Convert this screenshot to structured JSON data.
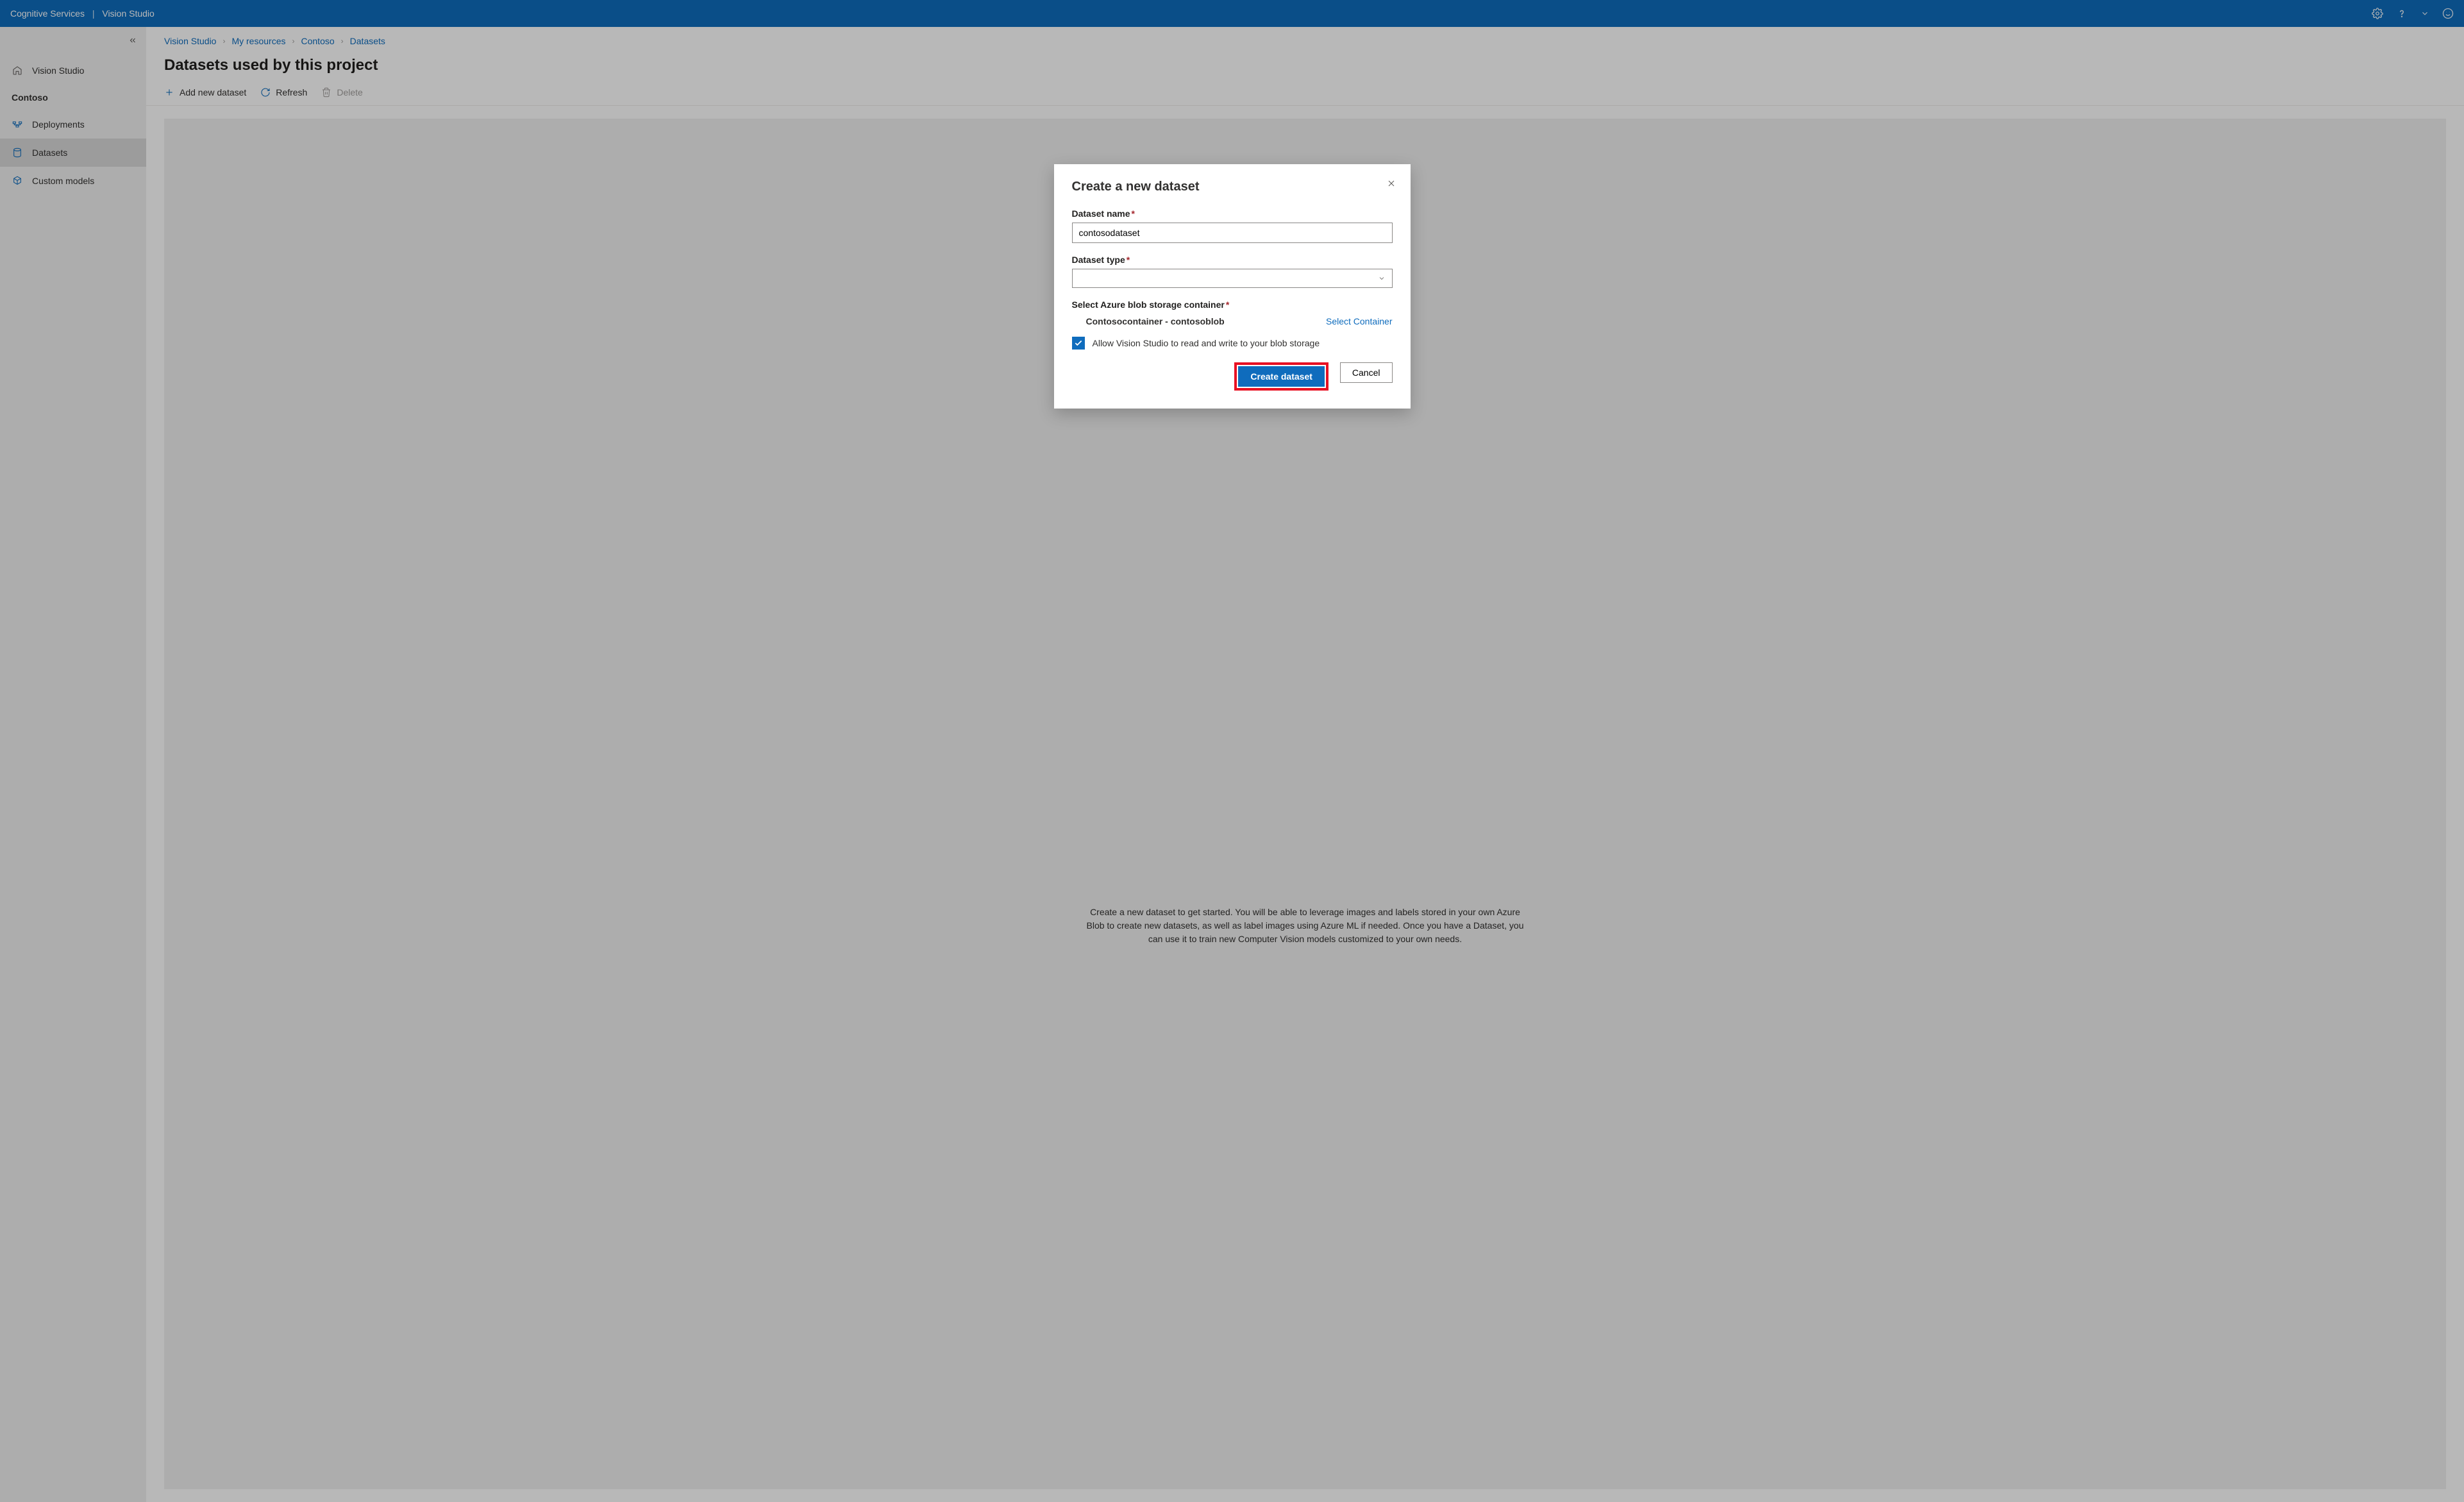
{
  "topbar": {
    "brand1": "Cognitive Services",
    "brand2": "Vision Studio"
  },
  "sidebar": {
    "home_label": "Vision Studio",
    "section_label": "Contoso",
    "items": [
      {
        "label": "Deployments"
      },
      {
        "label": "Datasets"
      },
      {
        "label": "Custom models"
      }
    ]
  },
  "breadcrumb": {
    "items": [
      "Vision Studio",
      "My resources",
      "Contoso",
      "Datasets"
    ]
  },
  "page": {
    "title": "Datasets used by this project",
    "toolbar": {
      "add_label": "Add new dataset",
      "refresh_label": "Refresh",
      "delete_label": "Delete"
    },
    "empty_desc": "Create a new dataset to get started. You will be able to leverage images and labels stored in your own Azure Blob to create new datasets, as well as label images using Azure ML if needed. Once you have a Dataset, you can use it to train new Computer Vision models customized to your own needs."
  },
  "dialog": {
    "title": "Create a new dataset",
    "fields": {
      "name_label": "Dataset name",
      "name_value": "contosodataset",
      "type_label": "Dataset type",
      "type_value": "",
      "container_label": "Select Azure blob storage container",
      "container_value": "Contosocontainer - contosoblob",
      "select_container_link": "Select Container"
    },
    "checkbox_label": "Allow Vision Studio to read and write to your blob storage",
    "checkbox_checked": true,
    "actions": {
      "create_label": "Create dataset",
      "cancel_label": "Cancel"
    }
  }
}
